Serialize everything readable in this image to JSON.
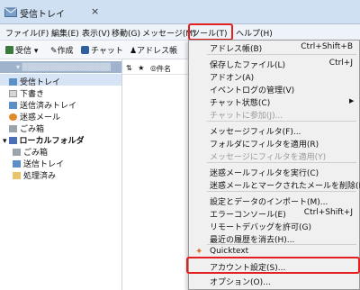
{
  "window": {
    "tab_title": "受信トレイ",
    "close_glyph": "×"
  },
  "menubar": {
    "file": "ファイル(F)",
    "edit": "編集(E)",
    "view": "表示(V)",
    "go": "移動(G)",
    "message": "メッセージ(M)",
    "tools": "ツール(T)",
    "help": "ヘルプ(H)"
  },
  "toolbar": {
    "get_mail": "受信",
    "write": "作成",
    "chat": "チャット",
    "address_book": "アドレス帳"
  },
  "folders": {
    "account_items": [
      "受信トレイ",
      "下書き",
      "送信済みトレイ",
      "迷惑メール",
      "ごみ箱"
    ],
    "local_folder": "ローカルフォルダ",
    "local_items": [
      "ごみ箱",
      "送信トレイ",
      "処理済み"
    ]
  },
  "message_list": {
    "star_col": "★",
    "name_col": "件名"
  },
  "tools_menu": [
    {
      "label": "アドレス帳(B)",
      "shortcut": "Ctrl+Shift+B"
    },
    {
      "label": "保存したファイル(L)",
      "shortcut": "Ctrl+J"
    },
    {
      "label": "アドオン(A)",
      "shortcut": ""
    },
    {
      "label": "イベントログの管理(V)",
      "shortcut": ""
    },
    {
      "label": "チャット状態(C)",
      "shortcut": ""
    },
    {
      "label": "チャットに参加(J)...",
      "shortcut": ""
    },
    {
      "label": "メッセージフィルタ(F)...",
      "shortcut": ""
    },
    {
      "label": "フォルダにフィルタを適用(R)",
      "shortcut": ""
    },
    {
      "label": "メッセージにフィルタを適用(Y)",
      "shortcut": ""
    },
    {
      "label": "迷惑メールフィルタを実行(C)",
      "shortcut": ""
    },
    {
      "label": "迷惑メールとマークされたメールを削除(D)",
      "shortcut": ""
    },
    {
      "label": "設定とデータのインポート(M)...",
      "shortcut": ""
    },
    {
      "label": "エラーコンソール(E)",
      "shortcut": "Ctrl+Shift+J"
    },
    {
      "label": "リモートデバッグを許可(G)",
      "shortcut": ""
    },
    {
      "label": "最近の履歴を消去(H)...",
      "shortcut": ""
    },
    {
      "label": "Quicktext",
      "shortcut": ""
    },
    {
      "label": "アカウント設定(S)...",
      "shortcut": ""
    },
    {
      "label": "オプション(O)...",
      "shortcut": ""
    }
  ],
  "colors": {
    "highlight_red": "#e51f1f",
    "selection": "#d6e4f5",
    "account_bg": "#9fb3cc"
  },
  "icons": [
    "thunderbird-icon",
    "get-mail-icon",
    "write-icon",
    "chat-icon",
    "address-book-icon",
    "quicktext-icon"
  ]
}
